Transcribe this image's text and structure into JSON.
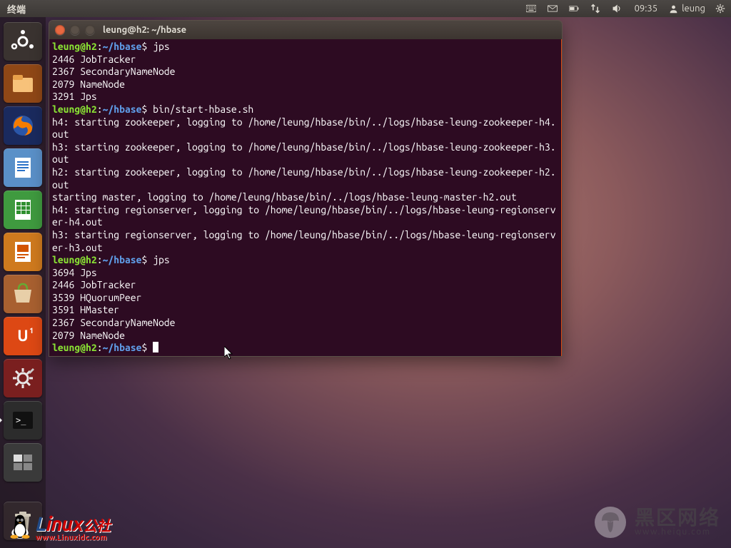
{
  "panel": {
    "app_menu_label": "终端",
    "clock": "09:35",
    "username": "leung"
  },
  "launcher": {
    "items": [
      {
        "name": "dash-icon"
      },
      {
        "name": "nautilus-icon"
      },
      {
        "name": "firefox-icon"
      },
      {
        "name": "writer-icon"
      },
      {
        "name": "calc-icon"
      },
      {
        "name": "impress-icon"
      },
      {
        "name": "software-center-icon"
      },
      {
        "name": "ubuntu-one-icon"
      },
      {
        "name": "settings-icon"
      },
      {
        "name": "terminal-icon"
      },
      {
        "name": "workspace-icon"
      },
      {
        "name": "trash-icon"
      }
    ]
  },
  "window": {
    "title": "leung@h2: ~/hbase"
  },
  "terminal": {
    "prompt_user_host": "leung@h2",
    "prompt_sep": ":",
    "prompt_path": "~/hbase",
    "prompt_symbol": "$",
    "cmd1": "jps",
    "out1_l1": "2446 JobTracker",
    "out1_l2": "2367 SecondaryNameNode",
    "out1_l3": "2079 NameNode",
    "out1_l4": "3291 Jps",
    "cmd2": "bin/start-hbase.sh",
    "out2_l1": "h4: starting zookeeper, logging to /home/leung/hbase/bin/../logs/hbase-leung-zookeeper-h4.out",
    "out2_l2": "h3: starting zookeeper, logging to /home/leung/hbase/bin/../logs/hbase-leung-zookeeper-h3.out",
    "out2_l3": "h2: starting zookeeper, logging to /home/leung/hbase/bin/../logs/hbase-leung-zookeeper-h2.out",
    "out2_l4": "starting master, logging to /home/leung/hbase/bin/../logs/hbase-leung-master-h2.out",
    "out2_l5": "h4: starting regionserver, logging to /home/leung/hbase/bin/../logs/hbase-leung-regionserver-h4.out",
    "out2_l6": "h3: starting regionserver, logging to /home/leung/hbase/bin/../logs/hbase-leung-regionserver-h3.out",
    "cmd3": "jps",
    "out3_l1": "3694 Jps",
    "out3_l2": "2446 JobTracker",
    "out3_l3": "3539 HQuorumPeer",
    "out3_l4": "3591 HMaster",
    "out3_l5": "2367 SecondaryNameNode",
    "out3_l6": "2079 NameNode"
  },
  "watermarks": {
    "left_big_part1": "L",
    "left_big_part2": "inux",
    "left_big_suffix": "公社",
    "left_url": "www.Linuxidc.com",
    "right_big": "黑区网络",
    "right_url": "www.heiqu.com"
  }
}
